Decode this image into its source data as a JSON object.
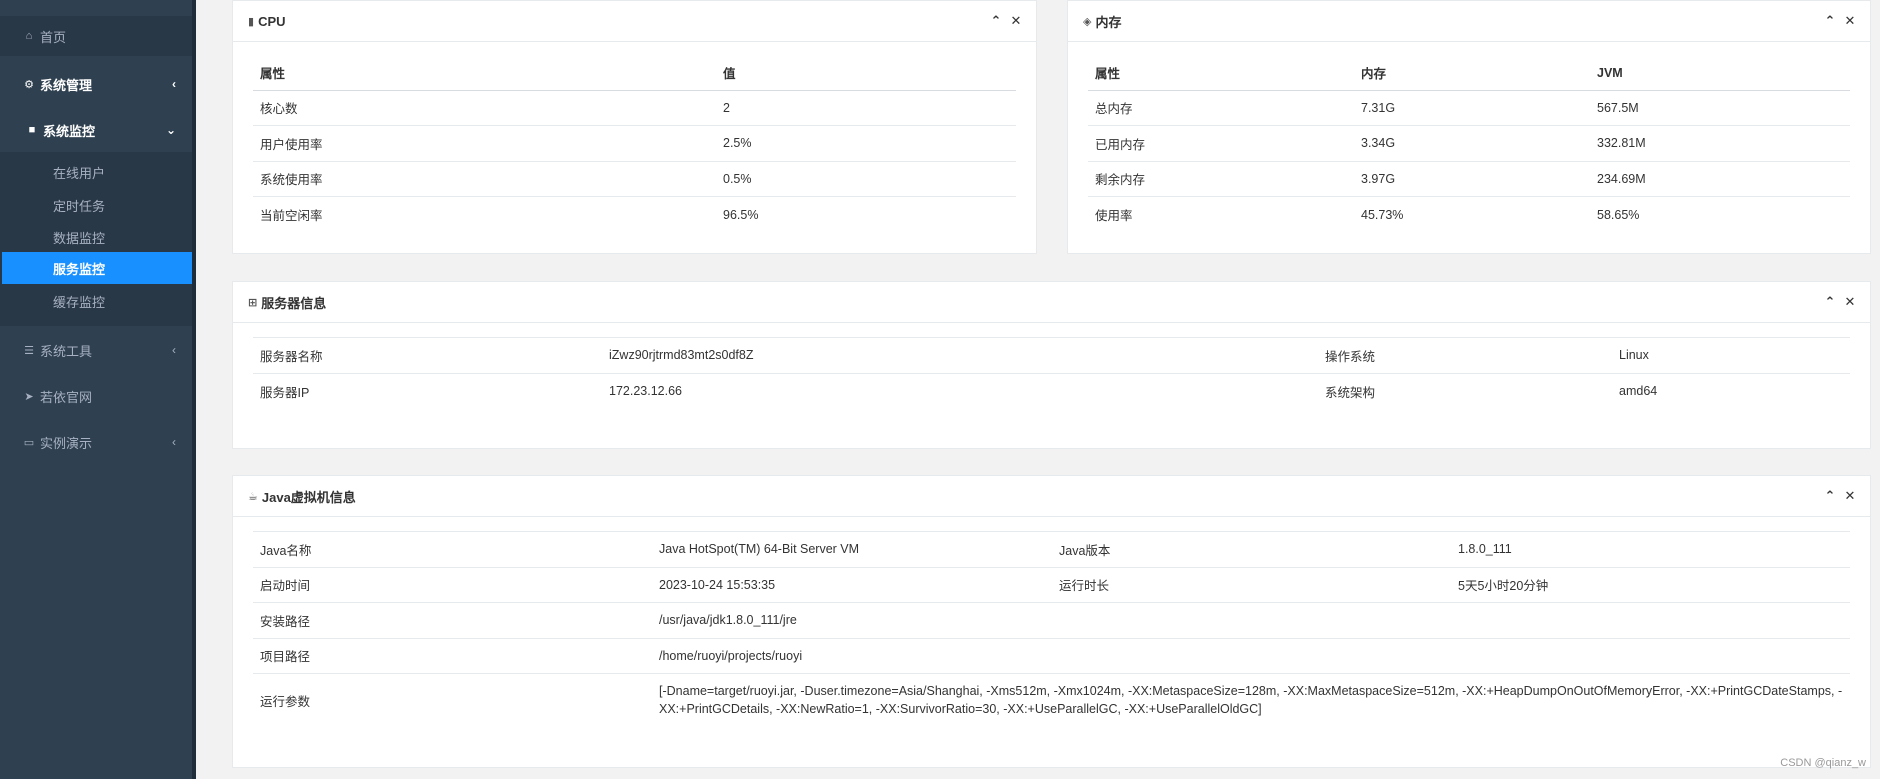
{
  "sidebar": {
    "home": "首页",
    "system_mgmt": "系统管理",
    "system_monitor": "系统监控",
    "monitor_items": [
      "在线用户",
      "定时任务",
      "数据监控",
      "服务监控",
      "缓存监控"
    ],
    "active_index": 3,
    "system_tools": "系统工具",
    "official_site": "若依官网",
    "demo": "实例演示",
    "arrow_collapsed": "‹",
    "arrow_expanded": "⌄"
  },
  "cpu": {
    "title": "CPU",
    "headers": [
      "属性",
      "值"
    ],
    "rows": [
      [
        "核心数",
        "2"
      ],
      [
        "用户使用率",
        "2.5%"
      ],
      [
        "系统使用率",
        "0.5%"
      ],
      [
        "当前空闲率",
        "96.5%"
      ]
    ]
  },
  "memory": {
    "title": "内存",
    "headers": [
      "属性",
      "内存",
      "JVM"
    ],
    "rows": [
      [
        "总内存",
        "7.31G",
        "567.5M"
      ],
      [
        "已用内存",
        "3.34G",
        "332.81M"
      ],
      [
        "剩余内存",
        "3.97G",
        "234.69M"
      ],
      [
        "使用率",
        "45.73%",
        "58.65%"
      ]
    ]
  },
  "server": {
    "title": "服务器信息",
    "rows": [
      [
        "服务器名称",
        "iZwz90rjtrmd83mt2s0df8Z",
        "操作系统",
        "Linux"
      ],
      [
        "服务器IP",
        "172.23.12.66",
        "系统架构",
        "amd64"
      ]
    ]
  },
  "jvm": {
    "title": "Java虚拟机信息",
    "rows4": [
      [
        "Java名称",
        "Java HotSpot(TM) 64-Bit Server VM",
        "Java版本",
        "1.8.0_111"
      ],
      [
        "启动时间",
        "2023-10-24 15:53:35",
        "运行时长",
        "5天5小时20分钟"
      ]
    ],
    "rows2": [
      [
        "安装路径",
        "/usr/java/jdk1.8.0_111/jre"
      ],
      [
        "项目路径",
        "/home/ruoyi/projects/ruoyi"
      ],
      [
        "运行参数",
        "[-Dname=target/ruoyi.jar, -Duser.timezone=Asia/Shanghai, -Xms512m, -Xmx1024m, -XX:MetaspaceSize=128m, -XX:MaxMetaspaceSize=512m, -XX:+HeapDumpOnOutOfMemoryError, -XX:+PrintGCDateStamps, -XX:+PrintGCDetails, -XX:NewRatio=1, -XX:SurvivorRatio=30, -XX:+UseParallelGC, -XX:+UseParallelOldGC]"
      ]
    ]
  },
  "tools": {
    "collapse": "⌃",
    "close": "✕"
  },
  "watermark": "CSDN @qianz_w"
}
